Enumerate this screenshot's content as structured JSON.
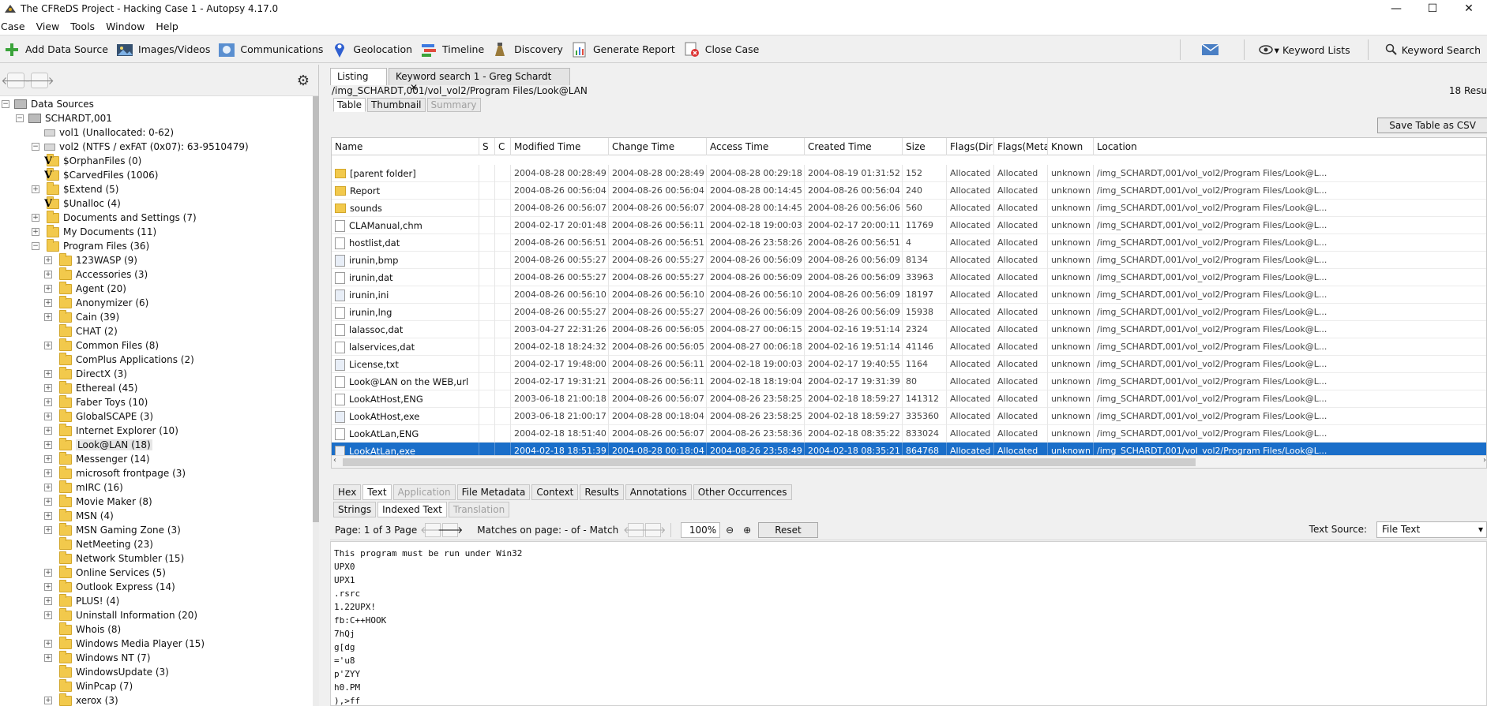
{
  "window": {
    "title": "The CFReDS Project - Hacking Case 1 - Autopsy 4.17.0",
    "minimize": "—",
    "maximize": "☐",
    "close": "✕"
  },
  "menu": [
    "Case",
    "View",
    "Tools",
    "Window",
    "Help"
  ],
  "toolbar": {
    "buttons": [
      {
        "label": "Add Data Source",
        "icon": "add-icon"
      },
      {
        "label": "Images/Videos",
        "icon": "images-icon"
      },
      {
        "label": "Communications",
        "icon": "communications-icon"
      },
      {
        "label": "Geolocation",
        "icon": "geolocation-icon"
      },
      {
        "label": "Timeline",
        "icon": "timeline-icon"
      },
      {
        "label": "Discovery",
        "icon": "discovery-icon"
      },
      {
        "label": "Generate Report",
        "icon": "report-icon"
      },
      {
        "label": "Close Case",
        "icon": "close-case-icon"
      }
    ],
    "keyword_lists": "Keyword Lists",
    "keyword_search": "Keyword Search"
  },
  "tree": [
    {
      "label": "Data Sources",
      "depth": 0,
      "exp": "−",
      "type": "root"
    },
    {
      "label": "SCHARDT,001",
      "depth": 1,
      "exp": "−",
      "type": "drive"
    },
    {
      "label": "vol1 (Unallocated: 0-62)",
      "depth": 2,
      "exp": "",
      "type": "vol"
    },
    {
      "label": "vol2 (NTFS / exFAT (0x07): 63-9510479)",
      "depth": 2,
      "exp": "−",
      "type": "vol"
    },
    {
      "label": "$OrphanFiles (0)",
      "depth": 3,
      "exp": "",
      "type": "vfolder"
    },
    {
      "label": "$CarvedFiles (1006)",
      "depth": 3,
      "exp": "",
      "type": "vfolder"
    },
    {
      "label": "$Extend (5)",
      "depth": 3,
      "exp": "+",
      "type": "folder"
    },
    {
      "label": "$Unalloc (4)",
      "depth": 3,
      "exp": "",
      "type": "vfolder"
    },
    {
      "label": "Documents and Settings (7)",
      "depth": 3,
      "exp": "+",
      "type": "folder"
    },
    {
      "label": "My Documents (11)",
      "depth": 3,
      "exp": "+",
      "type": "folder"
    },
    {
      "label": "Program Files (36)",
      "depth": 3,
      "exp": "−",
      "type": "folder"
    },
    {
      "label": "123WASP (9)",
      "depth": 4,
      "exp": "+",
      "type": "folder"
    },
    {
      "label": "Accessories (3)",
      "depth": 4,
      "exp": "+",
      "type": "folder"
    },
    {
      "label": "Agent (20)",
      "depth": 4,
      "exp": "+",
      "type": "folder"
    },
    {
      "label": "Anonymizer (6)",
      "depth": 4,
      "exp": "+",
      "type": "folder"
    },
    {
      "label": "Cain (39)",
      "depth": 4,
      "exp": "+",
      "type": "folder"
    },
    {
      "label": "CHAT (2)",
      "depth": 4,
      "exp": "",
      "type": "folder"
    },
    {
      "label": "Common Files (8)",
      "depth": 4,
      "exp": "+",
      "type": "folder"
    },
    {
      "label": "ComPlus Applications (2)",
      "depth": 4,
      "exp": "",
      "type": "folder"
    },
    {
      "label": "DirectX (3)",
      "depth": 4,
      "exp": "+",
      "type": "folder"
    },
    {
      "label": "Ethereal (45)",
      "depth": 4,
      "exp": "+",
      "type": "folder"
    },
    {
      "label": "Faber Toys (10)",
      "depth": 4,
      "exp": "+",
      "type": "folder"
    },
    {
      "label": "GlobalSCAPE (3)",
      "depth": 4,
      "exp": "+",
      "type": "folder"
    },
    {
      "label": "Internet Explorer (10)",
      "depth": 4,
      "exp": "+",
      "type": "folder"
    },
    {
      "label": "Look@LAN (18)",
      "depth": 4,
      "exp": "+",
      "type": "folder",
      "selected": true
    },
    {
      "label": "Messenger (14)",
      "depth": 4,
      "exp": "+",
      "type": "folder"
    },
    {
      "label": "microsoft frontpage (3)",
      "depth": 4,
      "exp": "+",
      "type": "folder"
    },
    {
      "label": "mIRC (16)",
      "depth": 4,
      "exp": "+",
      "type": "folder"
    },
    {
      "label": "Movie Maker (8)",
      "depth": 4,
      "exp": "+",
      "type": "folder"
    },
    {
      "label": "MSN (4)",
      "depth": 4,
      "exp": "+",
      "type": "folder"
    },
    {
      "label": "MSN Gaming Zone (3)",
      "depth": 4,
      "exp": "+",
      "type": "folder"
    },
    {
      "label": "NetMeeting (23)",
      "depth": 4,
      "exp": "",
      "type": "folder"
    },
    {
      "label": "Network Stumbler (15)",
      "depth": 4,
      "exp": "",
      "type": "folder"
    },
    {
      "label": "Online Services (5)",
      "depth": 4,
      "exp": "+",
      "type": "folder"
    },
    {
      "label": "Outlook Express (14)",
      "depth": 4,
      "exp": "+",
      "type": "folder"
    },
    {
      "label": "PLUS! (4)",
      "depth": 4,
      "exp": "+",
      "type": "folder"
    },
    {
      "label": "Uninstall Information (20)",
      "depth": 4,
      "exp": "+",
      "type": "folder"
    },
    {
      "label": "Whois (8)",
      "depth": 4,
      "exp": "",
      "type": "folder"
    },
    {
      "label": "Windows Media Player (15)",
      "depth": 4,
      "exp": "+",
      "type": "folder"
    },
    {
      "label": "Windows NT (7)",
      "depth": 4,
      "exp": "+",
      "type": "folder"
    },
    {
      "label": "WindowsUpdate (3)",
      "depth": 4,
      "exp": "",
      "type": "folder"
    },
    {
      "label": "WinPcap (7)",
      "depth": 4,
      "exp": "",
      "type": "folder"
    },
    {
      "label": "xerox (3)",
      "depth": 4,
      "exp": "+",
      "type": "folder"
    }
  ],
  "tabs": {
    "listing": "Listing",
    "keyword": "Keyword search 1 - Greg Schardt",
    "close": "✕"
  },
  "path": "/img_SCHARDT,001/vol_vol2/Program Files/Look@LAN",
  "result_count": "18 Resu",
  "view_tabs": [
    "Table",
    "Thumbnail",
    "Summary"
  ],
  "save_csv": "Save Table as CSV",
  "table": {
    "columns": [
      "Name",
      "S",
      "C",
      "Modified Time",
      "Change Time",
      "Access Time",
      "Created Time",
      "Size",
      "Flags(Dir)",
      "Flags(Meta)",
      "Known",
      "Location"
    ],
    "rows": [
      {
        "icon": "folder",
        "name": "[parent folder]",
        "modified": "2004-08-28 00:28:49 KST",
        "change": "2004-08-28 00:28:49 KST",
        "access": "2004-08-28 00:29:18 KST",
        "created": "2004-08-19 01:31:52 KST",
        "size": "152",
        "flags_dir": "Allocated",
        "flags_meta": "Allocated",
        "known": "unknown",
        "location": "/img_SCHARDT,001/vol_vol2/Program Files/Look@L..."
      },
      {
        "icon": "folder",
        "name": "Report",
        "modified": "2004-08-26 00:56:04 KST",
        "change": "2004-08-26 00:56:04 KST",
        "access": "2004-08-28 00:14:45 KST",
        "created": "2004-08-26 00:56:04 KST",
        "size": "240",
        "flags_dir": "Allocated",
        "flags_meta": "Allocated",
        "known": "unknown",
        "location": "/img_SCHARDT,001/vol_vol2/Program Files/Look@L..."
      },
      {
        "icon": "folder",
        "name": "sounds",
        "modified": "2004-08-26 00:56:07 KST",
        "change": "2004-08-26 00:56:07 KST",
        "access": "2004-08-28 00:14:45 KST",
        "created": "2004-08-26 00:56:06 KST",
        "size": "560",
        "flags_dir": "Allocated",
        "flags_meta": "Allocated",
        "known": "unknown",
        "location": "/img_SCHARDT,001/vol_vol2/Program Files/Look@L..."
      },
      {
        "icon": "file",
        "name": "CLAManual,chm",
        "modified": "2004-02-17 20:01:48 KST",
        "change": "2004-08-26 00:56:11 KST",
        "access": "2004-02-18 19:00:03 KST",
        "created": "2004-02-17 20:00:11 KST",
        "size": "11769",
        "flags_dir": "Allocated",
        "flags_meta": "Allocated",
        "known": "unknown",
        "location": "/img_SCHARDT,001/vol_vol2/Program Files/Look@L..."
      },
      {
        "icon": "file",
        "name": "hostlist,dat",
        "modified": "2004-08-26 00:56:51 KST",
        "change": "2004-08-26 00:56:51 KST",
        "access": "2004-08-26 23:58:26 KST",
        "created": "2004-08-26 00:56:51 KST",
        "size": "4",
        "flags_dir": "Allocated",
        "flags_meta": "Allocated",
        "known": "unknown",
        "location": "/img_SCHARDT,001/vol_vol2/Program Files/Look@L..."
      },
      {
        "icon": "image",
        "name": "irunin,bmp",
        "modified": "2004-08-26 00:55:27 KST",
        "change": "2004-08-26 00:55:27 KST",
        "access": "2004-08-26 00:56:09 KST",
        "created": "2004-08-26 00:56:09 KST",
        "size": "8134",
        "flags_dir": "Allocated",
        "flags_meta": "Allocated",
        "known": "unknown",
        "location": "/img_SCHARDT,001/vol_vol2/Program Files/Look@L..."
      },
      {
        "icon": "file",
        "name": "irunin,dat",
        "modified": "2004-08-26 00:55:27 KST",
        "change": "2004-08-26 00:55:27 KST",
        "access": "2004-08-26 00:56:09 KST",
        "created": "2004-08-26 00:56:09 KST",
        "size": "33963",
        "flags_dir": "Allocated",
        "flags_meta": "Allocated",
        "known": "unknown",
        "location": "/img_SCHARDT,001/vol_vol2/Program Files/Look@L..."
      },
      {
        "icon": "exe",
        "name": "irunin,ini",
        "modified": "2004-08-26 00:56:10 KST",
        "change": "2004-08-26 00:56:10 KST",
        "access": "2004-08-26 00:56:10 KST",
        "created": "2004-08-26 00:56:09 KST",
        "size": "18197",
        "flags_dir": "Allocated",
        "flags_meta": "Allocated",
        "known": "unknown",
        "location": "/img_SCHARDT,001/vol_vol2/Program Files/Look@L..."
      },
      {
        "icon": "file",
        "name": "irunin,lng",
        "modified": "2004-08-26 00:55:27 KST",
        "change": "2004-08-26 00:55:27 KST",
        "access": "2004-08-26 00:56:09 KST",
        "created": "2004-08-26 00:56:09 KST",
        "size": "15938",
        "flags_dir": "Allocated",
        "flags_meta": "Allocated",
        "known": "unknown",
        "location": "/img_SCHARDT,001/vol_vol2/Program Files/Look@L..."
      },
      {
        "icon": "file",
        "name": "lalassoc,dat",
        "modified": "2003-04-27 22:31:26 KST",
        "change": "2004-08-26 00:56:05 KST",
        "access": "2004-08-27 00:06:15 KST",
        "created": "2004-02-16 19:51:14 KST",
        "size": "2324",
        "flags_dir": "Allocated",
        "flags_meta": "Allocated",
        "known": "unknown",
        "location": "/img_SCHARDT,001/vol_vol2/Program Files/Look@L..."
      },
      {
        "icon": "file",
        "name": "lalservices,dat",
        "modified": "2004-02-18 18:24:32 KST",
        "change": "2004-08-26 00:56:05 KST",
        "access": "2004-08-27 00:06:18 KST",
        "created": "2004-02-16 19:51:14 KST",
        "size": "41146",
        "flags_dir": "Allocated",
        "flags_meta": "Allocated",
        "known": "unknown",
        "location": "/img_SCHARDT,001/vol_vol2/Program Files/Look@L..."
      },
      {
        "icon": "exe",
        "name": "License,txt",
        "modified": "2004-02-17 19:48:00 KST",
        "change": "2004-08-26 00:56:11 KST",
        "access": "2004-02-18 19:00:03 KST",
        "created": "2004-02-17 19:40:55 KST",
        "size": "1164",
        "flags_dir": "Allocated",
        "flags_meta": "Allocated",
        "known": "unknown",
        "location": "/img_SCHARDT,001/vol_vol2/Program Files/Look@L..."
      },
      {
        "icon": "file",
        "name": "Look@LAN on the WEB,url",
        "modified": "2004-02-17 19:31:21 KST",
        "change": "2004-08-26 00:56:11 KST",
        "access": "2004-02-18 18:19:04 KST",
        "created": "2004-02-17 19:31:39 KST",
        "size": "80",
        "flags_dir": "Allocated",
        "flags_meta": "Allocated",
        "known": "unknown",
        "location": "/img_SCHARDT,001/vol_vol2/Program Files/Look@L..."
      },
      {
        "icon": "file",
        "name": "LookAtHost,ENG",
        "modified": "2003-06-18 21:00:18 KST",
        "change": "2004-08-26 00:56:07 KST",
        "access": "2004-08-26 23:58:25 KST",
        "created": "2004-02-18 18:59:27 KST",
        "size": "141312",
        "flags_dir": "Allocated",
        "flags_meta": "Allocated",
        "known": "unknown",
        "location": "/img_SCHARDT,001/vol_vol2/Program Files/Look@L..."
      },
      {
        "icon": "exe",
        "name": "LookAtHost,exe",
        "modified": "2003-06-18 21:00:17 KST",
        "change": "2004-08-28 00:18:04 KST",
        "access": "2004-08-26 23:58:25 KST",
        "created": "2004-02-18 18:59:27 KST",
        "size": "335360",
        "flags_dir": "Allocated",
        "flags_meta": "Allocated",
        "known": "unknown",
        "location": "/img_SCHARDT,001/vol_vol2/Program Files/Look@L..."
      },
      {
        "icon": "file",
        "name": "LookAtLan,ENG",
        "modified": "2004-02-18 18:51:40 KST",
        "change": "2004-08-26 00:56:07 KST",
        "access": "2004-08-26 23:58:36 KST",
        "created": "2004-02-18 08:35:22 KST",
        "size": "833024",
        "flags_dir": "Allocated",
        "flags_meta": "Allocated",
        "known": "unknown",
        "location": "/img_SCHARDT,001/vol_vol2/Program Files/Look@L..."
      },
      {
        "icon": "exe",
        "name": "LookAtLan,exe",
        "modified": "2004-02-18 18:51:39 KST",
        "change": "2004-08-28 00:18:04 KST",
        "access": "2004-08-26 23:58:49 KST",
        "created": "2004-02-18 08:35:21 KST",
        "size": "864768",
        "flags_dir": "Allocated",
        "flags_meta": "Allocated",
        "known": "unknown",
        "location": "/img_SCHARDT,001/vol_vol2/Program Files/Look@L...",
        "selected": true
      }
    ]
  },
  "content_tabs": [
    "Hex",
    "Text",
    "Application",
    "File Metadata",
    "Context",
    "Results",
    "Annotations",
    "Other Occurrences"
  ],
  "text_tabs": [
    "Strings",
    "Indexed Text",
    "Translation"
  ],
  "pager": {
    "page": "Page: 1 of 3 Page",
    "matches": "Matches on page: - of - Match",
    "zoom": "100%",
    "reset": "Reset",
    "text_source_label": "Text Source:",
    "text_source_value": "File Text"
  },
  "text_content": "This program must be run under Win32\nUPX0\nUPX1\n.rsrc\n1.22UPX!\nfb:C++HOOK\n7hQj\ng[dg\n='u8\np'ZYY\nh0.PM\n),>ff"
}
